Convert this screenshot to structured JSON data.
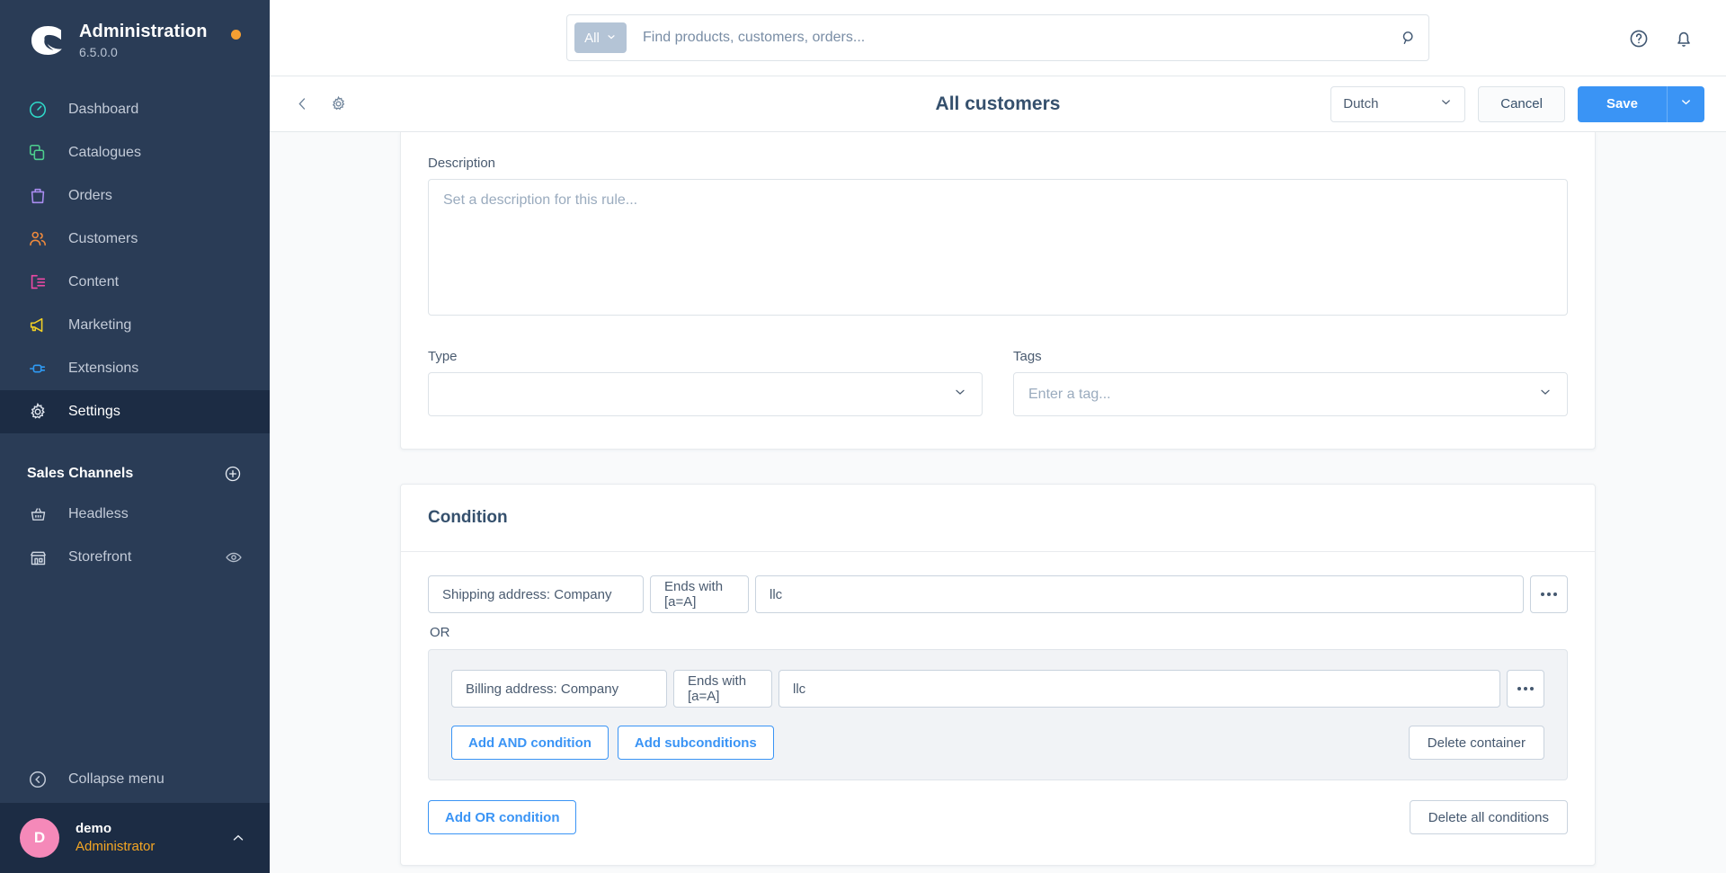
{
  "sidebar": {
    "brand": {
      "title": "Administration",
      "version": "6.5.0.0",
      "logo_icon": "shopware-logo-icon",
      "status_dot_color": "#f59f32"
    },
    "items": [
      {
        "label": "Dashboard",
        "icon": "dashboard-gauge-icon",
        "color": "#2fd8c8",
        "active": false
      },
      {
        "label": "Catalogues",
        "icon": "catalogue-layers-icon",
        "color": "#4dcf8e",
        "active": false
      },
      {
        "label": "Orders",
        "icon": "orders-bag-icon",
        "color": "#a98cf0",
        "active": false
      },
      {
        "label": "Customers",
        "icon": "customers-people-icon",
        "color": "#f08a3c",
        "active": false
      },
      {
        "label": "Content",
        "icon": "content-page-icon",
        "color": "#ef49a6",
        "active": false
      },
      {
        "label": "Marketing",
        "icon": "marketing-megaphone-icon",
        "color": "#f2d024",
        "active": false
      },
      {
        "label": "Extensions",
        "icon": "extensions-plug-icon",
        "color": "#2f9bf5",
        "active": false
      },
      {
        "label": "Settings",
        "icon": "settings-gear-icon",
        "color": "#c3cbd8",
        "active": true
      }
    ],
    "sales_channels": {
      "title": "Sales Channels",
      "add_icon": "plus-circle-icon",
      "items": [
        {
          "label": "Headless",
          "icon": "basket-icon",
          "trailing_icon": ""
        },
        {
          "label": "Storefront",
          "icon": "storefront-shop-icon",
          "trailing_icon": "eye-icon"
        }
      ]
    },
    "collapse": {
      "label": "Collapse menu",
      "icon": "collapse-arrow-left-icon"
    },
    "user": {
      "initial": "D",
      "name": "demo",
      "role": "Administrator",
      "caret_icon": "chevron-up-icon"
    }
  },
  "topbar": {
    "search": {
      "scope_label": "All",
      "scope_caret_icon": "chevron-down-icon",
      "placeholder": "Find products, customers, orders...",
      "value": "",
      "search_icon": "search-icon"
    },
    "help_icon": "help-question-circle-icon",
    "notifications_icon": "bell-icon"
  },
  "pagehead": {
    "back_icon": "chevron-left-icon",
    "settings_icon": "gear-icon",
    "title": "All customers",
    "language": {
      "value": "Dutch",
      "caret_icon": "chevron-down-icon"
    },
    "cancel_label": "Cancel",
    "save_label": "Save",
    "save_caret_icon": "chevron-down-icon",
    "save_color": "#3a94f5"
  },
  "form": {
    "description": {
      "label": "Description",
      "placeholder": "Set a description for this rule...",
      "value": ""
    },
    "type": {
      "label": "Type",
      "value": "",
      "placeholder": "",
      "caret_icon": "chevron-down-icon"
    },
    "tags": {
      "label": "Tags",
      "value": "",
      "placeholder": "Enter a tag...",
      "caret_icon": "chevron-down-icon"
    }
  },
  "condition": {
    "title": "Condition",
    "root_rule": {
      "type": "Shipping address: Company",
      "operator": "Ends with [a=A]",
      "value": "llc",
      "more_icon": "ellipsis-icon"
    },
    "or_label": "OR",
    "subcontainer": {
      "rule": {
        "type": "Billing address: Company",
        "operator": "Ends with [a=A]",
        "value": "llc",
        "more_icon": "ellipsis-icon"
      },
      "add_and_label": "Add AND condition",
      "add_sub_label": "Add subconditions",
      "delete_container_label": "Delete container"
    },
    "add_or_label": "Add OR condition",
    "delete_all_label": "Delete all conditions"
  }
}
